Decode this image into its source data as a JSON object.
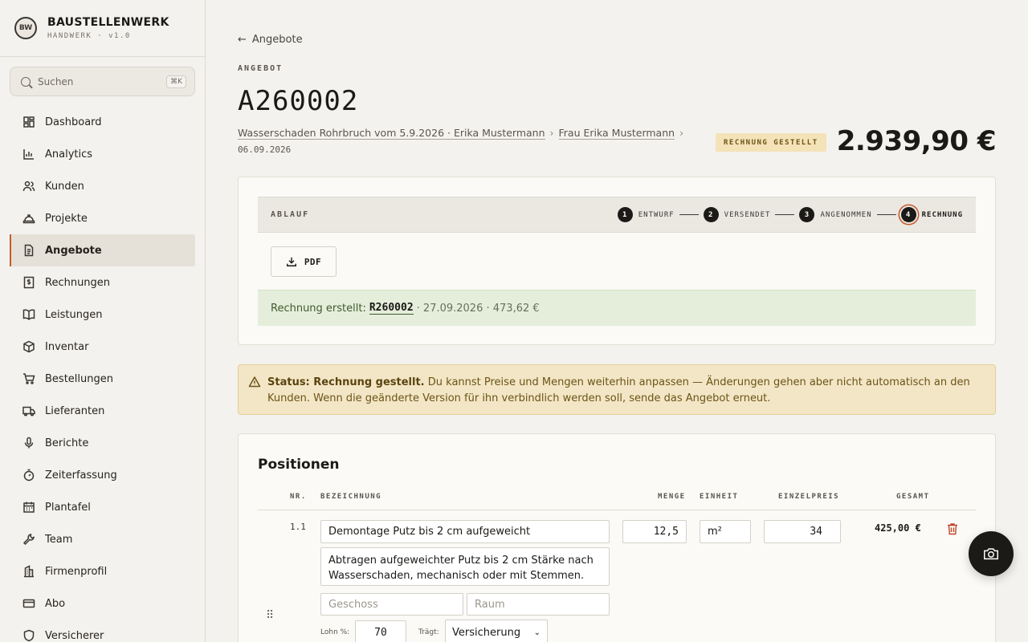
{
  "brand": {
    "logo": "BW",
    "name": "BAUSTELLENWERK",
    "sub": "HANDWERK · v1.0"
  },
  "search": {
    "placeholder": "Suchen",
    "shortcut": "⌘K"
  },
  "nav": [
    {
      "label": "Dashboard",
      "icon": "dashboard-icon"
    },
    {
      "label": "Analytics",
      "icon": "chart-icon"
    },
    {
      "label": "Kunden",
      "icon": "users-icon"
    },
    {
      "label": "Projekte",
      "icon": "helmet-icon"
    },
    {
      "label": "Angebote",
      "icon": "document-icon",
      "active": true
    },
    {
      "label": "Rechnungen",
      "icon": "invoice-icon"
    },
    {
      "label": "Leistungen",
      "icon": "book-icon"
    },
    {
      "label": "Inventar",
      "icon": "box-icon"
    },
    {
      "label": "Bestellungen",
      "icon": "cart-icon"
    },
    {
      "label": "Lieferanten",
      "icon": "truck-icon"
    },
    {
      "label": "Berichte",
      "icon": "mic-icon"
    },
    {
      "label": "Zeiterfassung",
      "icon": "stopwatch-icon"
    },
    {
      "label": "Plantafel",
      "icon": "calendar-icon"
    },
    {
      "label": "Team",
      "icon": "wrench-icon"
    },
    {
      "label": "Firmenprofil",
      "icon": "building-icon"
    },
    {
      "label": "Abo",
      "icon": "card-icon"
    },
    {
      "label": "Versicherer",
      "icon": "shield-icon"
    }
  ],
  "header": {
    "back_label": "Angebote",
    "eyebrow": "ANGEBOT",
    "title": "A260002",
    "project": "Wasserschaden Rohrbruch vom 5.9.2026 · Erika Mustermann",
    "customer": "Frau Erika Mustermann",
    "date": "06.09.2026",
    "status_badge": "RECHNUNG GESTELLT",
    "total": "2.939,90 €"
  },
  "workflow": {
    "label": "ABLAUF",
    "steps": [
      {
        "num": "1",
        "label": "ENTWURF"
      },
      {
        "num": "2",
        "label": "VERSENDET"
      },
      {
        "num": "3",
        "label": "ANGENOMMEN"
      },
      {
        "num": "4",
        "label": "RECHNUNG",
        "current": true
      }
    ],
    "pdf_label": "PDF",
    "invoice_prefix": "Rechnung erstellt:",
    "invoice_number": "R260002",
    "invoice_rest": "· 27.09.2026 · 473,62 €"
  },
  "warning": {
    "strong": "Status: Rechnung gestellt.",
    "text": " Du kannst Preise und Mengen weiterhin anpassen — Änderungen gehen aber nicht automatisch an den Kunden. Wenn die geänderte Version für ihn verbindlich werden soll, sende das Angebot erneut."
  },
  "positions": {
    "title": "Positionen",
    "columns": {
      "nr": "NR.",
      "bezeichnung": "BEZEICHNUNG",
      "menge": "MENGE",
      "einheit": "EINHEIT",
      "einzelpreis": "EINZELPREIS",
      "gesamt": "GESAMT"
    },
    "rows": [
      {
        "nr": "1.1",
        "bezeichnung": "Demontage Putz bis 2 cm aufgeweicht",
        "beschreibung": "Abtragen aufgeweichter Putz bis 2 cm Stärke nach Wasserschaden, mechanisch oder mit Stemmen. Bis",
        "menge": "12,5",
        "einheit": "m²",
        "einzelpreis": "34",
        "gesamt": "425,00 €",
        "geschoss_placeholder": "Geschoss",
        "raum_placeholder": "Raum",
        "lohn_label": "Lohn %:",
        "lohn_value": "70",
        "traegt_label": "Trägt:",
        "traegt_value": "Versicherung"
      }
    ]
  }
}
